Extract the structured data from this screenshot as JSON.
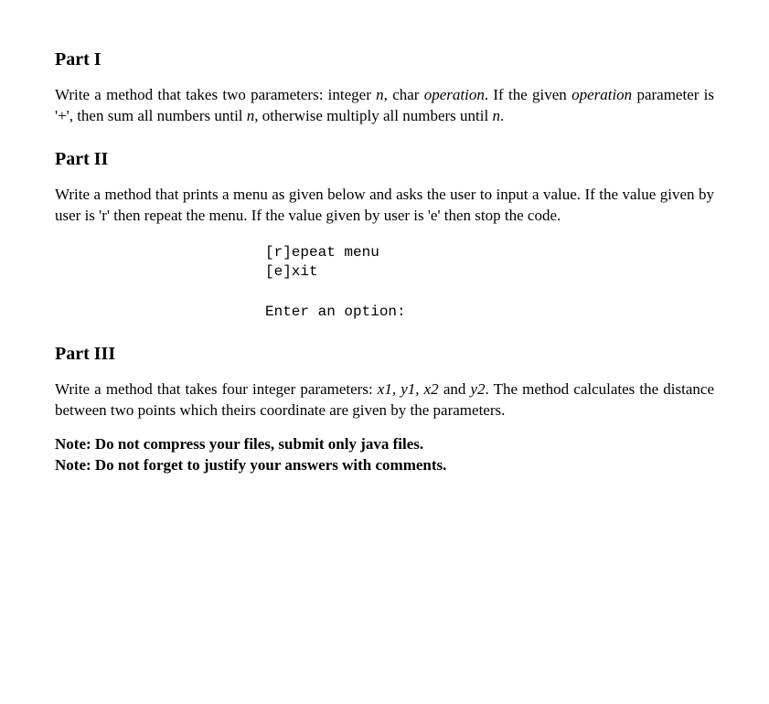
{
  "part1": {
    "heading": "Part I",
    "text_a": "Write a method that takes two parameters: integer ",
    "var_n1": "n",
    "text_b": ", char ",
    "var_op1": "operation",
    "text_c": ". If the given ",
    "var_op2": "operation",
    "text_d": " parameter is '+', then sum all numbers until ",
    "var_n2": "n",
    "text_e": ", otherwise multiply all numbers until ",
    "var_n3": "n",
    "text_f": "."
  },
  "part2": {
    "heading": "Part II",
    "text": "Write a method that prints a menu as given below and asks the user to input a value. If the value given by user is 'r' then repeat the menu. If the value given by user is 'e' then stop the code.",
    "code": "[r]epeat menu\n[e]xit\n\nEnter an option:"
  },
  "part3": {
    "heading": "Part III",
    "text_a": "Write a method that takes four integer parameters: ",
    "vars": "x1, y1, x2",
    "text_b": " and ",
    "var_y2": "y2",
    "text_c": ". The method calculates the distance between two points which theirs coordinate are given by the parameters."
  },
  "notes": {
    "note1": "Note: Do not compress your files, submit only java files.",
    "note2": "Note: Do not forget to justify your answers with comments."
  }
}
